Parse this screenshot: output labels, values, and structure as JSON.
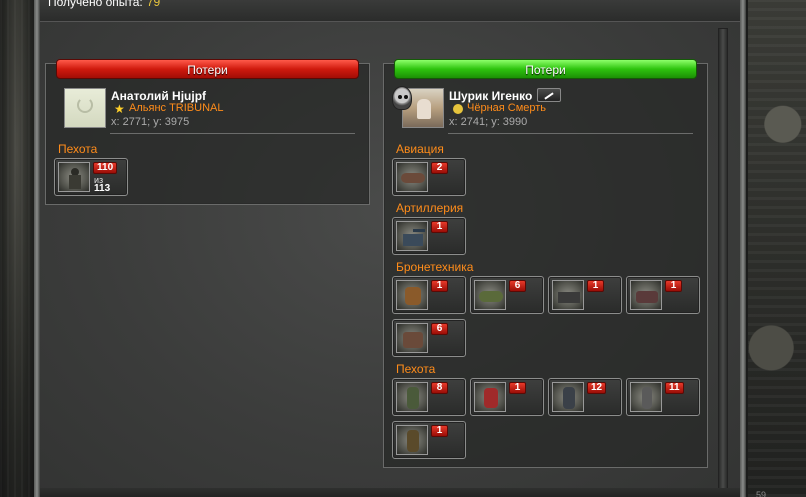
{
  "header": {
    "exp_label": "Получено опыта:",
    "exp_value": "79"
  },
  "left_panel": {
    "banner": "Потери",
    "player": {
      "name": "Анатолий Hjujpf",
      "alliance": "Альянс TRIBUNAL",
      "coords": "x: 2771; y: 3975"
    },
    "sections": [
      {
        "title": "Пехота",
        "units": [
          {
            "icon": "infantry-soldier-icon",
            "count": "110",
            "of_label": "из",
            "total": "113"
          }
        ]
      }
    ]
  },
  "right_panel": {
    "banner": "Потери",
    "player": {
      "name": "Шурик Игенко",
      "alliance": "Чёрная Смерть",
      "coords": "x: 2741; y: 3990"
    },
    "sections": [
      {
        "title": "Авиация",
        "units": [
          {
            "icon": "aircraft-icon",
            "count": "2"
          }
        ]
      },
      {
        "title": "Артиллерия",
        "units": [
          {
            "icon": "artillery-icon",
            "count": "1"
          }
        ]
      },
      {
        "title": "Бронетехника",
        "units": [
          {
            "icon": "walker-mech-icon",
            "count": "1"
          },
          {
            "icon": "hover-tank-icon",
            "count": "6"
          },
          {
            "icon": "armored-vehicle-icon",
            "count": "1"
          },
          {
            "icon": "assault-buggy-icon",
            "count": "1"
          },
          {
            "icon": "spider-mech-icon",
            "count": "6"
          }
        ]
      },
      {
        "title": "Пехота",
        "units": [
          {
            "icon": "heavy-trooper-icon",
            "count": "8"
          },
          {
            "icon": "red-cyborg-icon",
            "count": "1"
          },
          {
            "icon": "armored-soldier-icon",
            "count": "12"
          },
          {
            "icon": "sniper-icon",
            "count": "11"
          },
          {
            "icon": "grenadier-icon",
            "count": "1"
          }
        ]
      }
    ]
  },
  "colors": {
    "accent_orange": "#ff8c1a",
    "loss_red": "#d01a0e",
    "win_green": "#2ec40e",
    "exp_yellow": "#e6c43c"
  },
  "corner_text": "59"
}
